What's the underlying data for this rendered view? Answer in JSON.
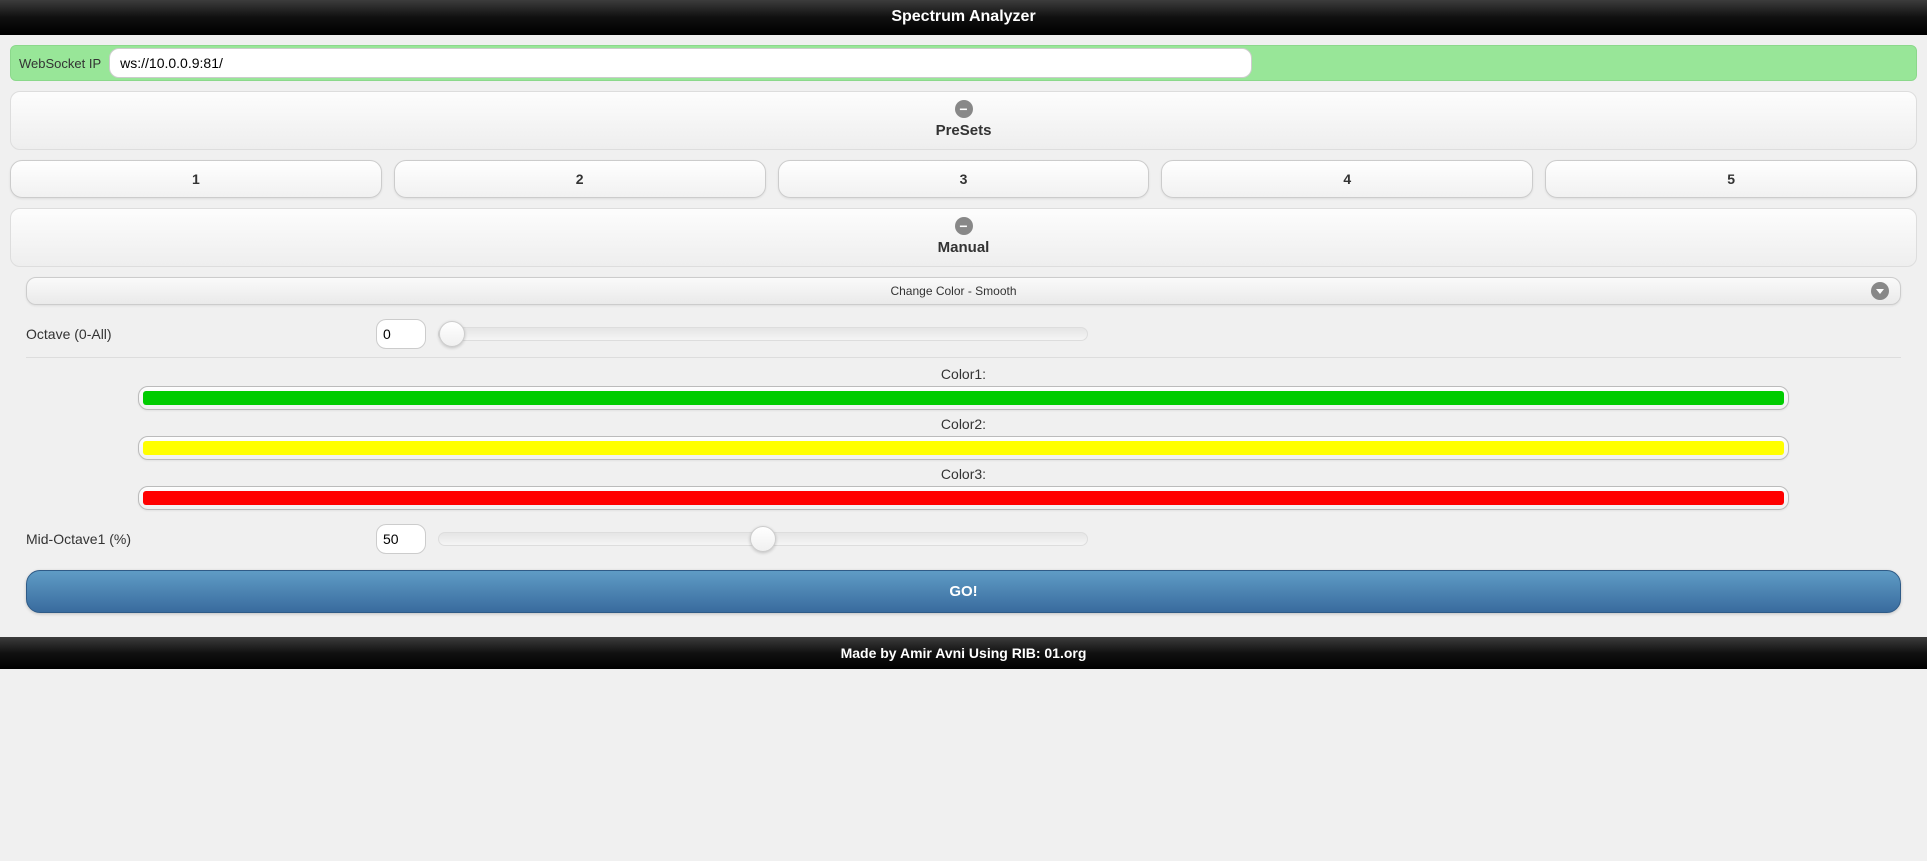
{
  "header": {
    "title": "Spectrum Analyzer"
  },
  "websocket": {
    "label": "WebSocket IP",
    "value": "ws://10.0.0.9:81/",
    "status_color": "#98e698"
  },
  "presets": {
    "title": "PreSets",
    "items": [
      {
        "label": "1"
      },
      {
        "label": "2"
      },
      {
        "label": "3"
      },
      {
        "label": "4"
      },
      {
        "label": "5"
      }
    ]
  },
  "manual": {
    "title": "Manual",
    "mode_select": {
      "selected": "Change Color - Smooth"
    },
    "octave": {
      "label": "Octave (0-All)",
      "value": "0",
      "slider_pos_pct": 2
    },
    "colors": [
      {
        "label": "Color1:",
        "hex": "#00cc00"
      },
      {
        "label": "Color2:",
        "hex": "#ffff00"
      },
      {
        "label": "Color3:",
        "hex": "#ff0000"
      }
    ],
    "mid_octave": {
      "label": "Mid-Octave1 (%)",
      "value": "50",
      "slider_pos_pct": 50
    },
    "go_label": "GO!"
  },
  "footer": {
    "text": "Made by Amir Avni Using RIB: 01.org"
  }
}
